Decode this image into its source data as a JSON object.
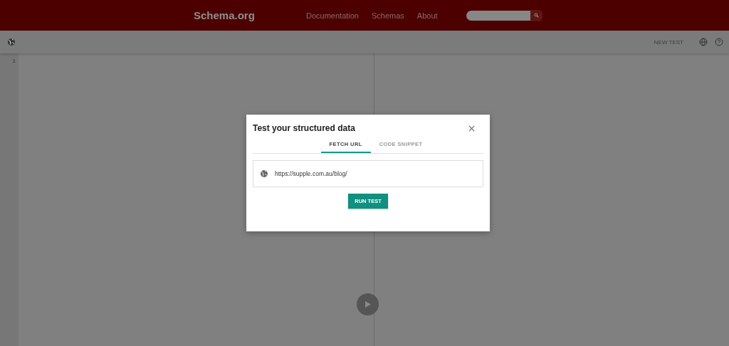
{
  "header": {
    "logo": "Schema.org",
    "nav": [
      "Documentation",
      "Schemas",
      "About"
    ]
  },
  "toolbar": {
    "button": "NEW TEST"
  },
  "editor": {
    "line_numbers": [
      "1"
    ]
  },
  "dialog": {
    "title": "Test your structured data",
    "tabs": [
      {
        "label": "FETCH URL",
        "selected": true
      },
      {
        "label": "CODE SNIPPET",
        "selected": false
      }
    ],
    "url_field": {
      "value": "https://supple.com.au/blog/"
    },
    "button": "RUN TEST"
  }
}
